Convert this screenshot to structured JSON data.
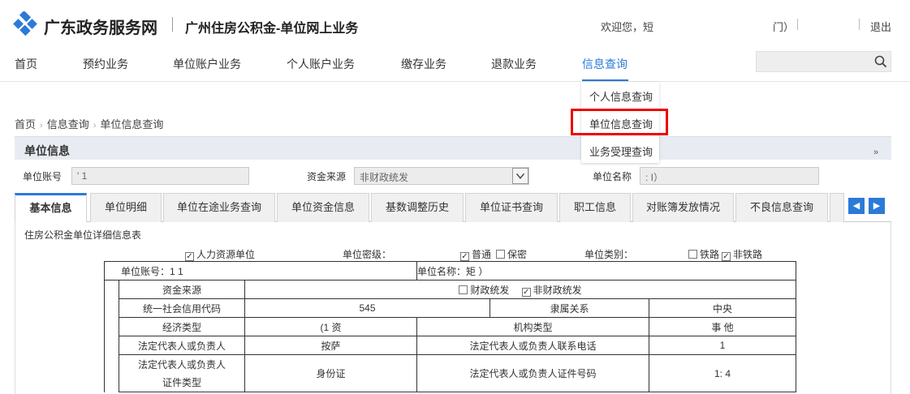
{
  "header": {
    "brand": "广东政务服务网",
    "subbrand": "广州住房公积金-单位网上业务",
    "welcome": "欢迎您，短",
    "welcome_tail": "门）",
    "logout": "退出"
  },
  "nav": {
    "items": [
      "首页",
      "预约业务",
      "单位账户业务",
      "个人账户业务",
      "缴存业务",
      "退款业务",
      "信息查询"
    ],
    "active": "信息查询",
    "search_placeholder": ""
  },
  "dropdown": {
    "items": [
      "个人信息查询",
      "单位信息查询",
      "业务受理查询"
    ],
    "highlighted": "单位信息查询"
  },
  "breadcrumb": [
    "首页",
    "信息查询",
    "单位信息查询"
  ],
  "panel": {
    "title": "单位信息",
    "fields": {
      "account_label": "单位账号",
      "account_value": "'          1",
      "fund_label": "资金来源",
      "fund_value": "非财政统发",
      "name_label": "单位名称",
      "name_value": ":                                              I）"
    }
  },
  "tabs": [
    "基本信息",
    "单位明细",
    "单位在途业务查询",
    "单位资金信息",
    "基数调整历史",
    "单位证书查询",
    "职工信息",
    "对账簿发放情况",
    "不良信息查询"
  ],
  "active_tab": "基本信息",
  "detail": {
    "section_title": "住房公积金单位详细信息表",
    "hr_unit": "人力资源单位",
    "secret_label": "单位密级：",
    "secret_normal": "普通",
    "secret_confidential": "保密",
    "category_label": "单位类别：",
    "cat_railway": "铁路",
    "cat_nonrailway": "非铁路",
    "row_account": "单位账号：1          1",
    "row_name": "单位名称：矩                                    ）",
    "fund_source": "资金来源",
    "fiscal": "财政统发",
    "nonfiscal": "非财政统发",
    "credit_code_label": "统一社会信用代码",
    "credit_code_value": "545",
    "affiliation_label": "隶属关系",
    "affiliation_value": "中央",
    "econ_type_label": "经济类型",
    "econ_type_value": "(1        资",
    "org_type_label": "机构类型",
    "org_type_value": "事        他",
    "legal_rep_label": "法定代表人或负责人",
    "legal_rep_value": "按萨",
    "legal_phone_label": "法定代表人或负责人联系电话",
    "legal_phone_value": "1",
    "id_type_label_1": "法定代表人或负责人",
    "id_type_label_2": "证件类型",
    "id_type_value": "身份证",
    "id_no_label": "法定代表人或负责人证件号码",
    "id_no_value": "1:                              4"
  },
  "colors": {
    "accent": "#2b7ad8",
    "highlight": "#e00000"
  }
}
